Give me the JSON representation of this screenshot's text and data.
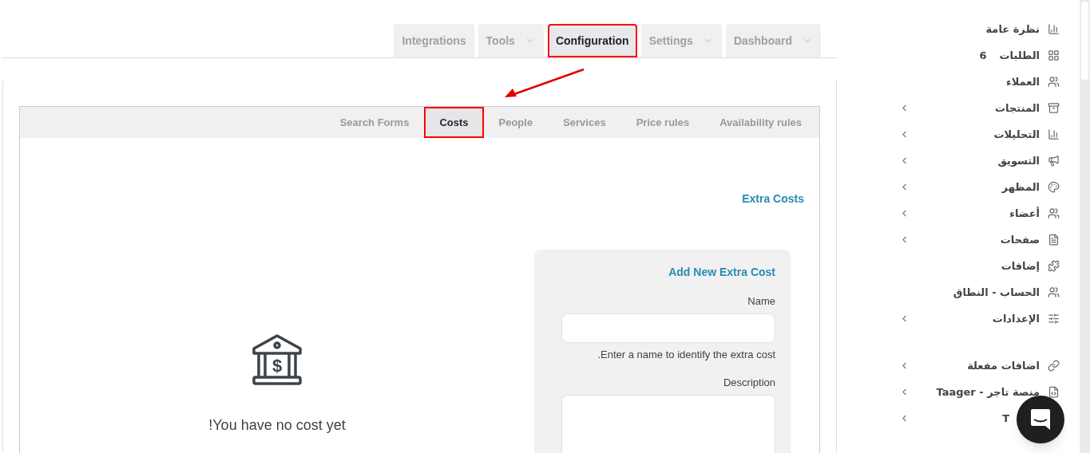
{
  "top_tabs": [
    {
      "label": "Dashboard",
      "selected": false,
      "dropdown": true,
      "highlighted": false
    },
    {
      "label": "Settings",
      "selected": false,
      "dropdown": true,
      "highlighted": false
    },
    {
      "label": "Configuration",
      "selected": true,
      "dropdown": false,
      "highlighted": true
    },
    {
      "label": "Tools",
      "selected": false,
      "dropdown": true,
      "highlighted": false
    },
    {
      "label": "Integrations",
      "selected": false,
      "dropdown": false,
      "highlighted": false
    }
  ],
  "sub_tabs": [
    {
      "label": "Availability rules",
      "selected": false,
      "highlighted": false
    },
    {
      "label": "Price rules",
      "selected": false,
      "highlighted": false
    },
    {
      "label": "Services",
      "selected": false,
      "highlighted": false
    },
    {
      "label": "People",
      "selected": false,
      "highlighted": false
    },
    {
      "label": "Costs",
      "selected": true,
      "highlighted": true
    },
    {
      "label": "Search Forms",
      "selected": false,
      "highlighted": false
    }
  ],
  "section_title": "Extra Costs",
  "empty_state": {
    "icon_symbol": "$",
    "message": "!You have no cost yet"
  },
  "form": {
    "title": "Add New Extra Cost",
    "fields": [
      {
        "kind": "input",
        "label": "Name",
        "help": ".Enter a name to identify the extra cost"
      },
      {
        "kind": "textarea",
        "label": "Description"
      }
    ]
  },
  "sidebar": {
    "groups": [
      {
        "items": [
          {
            "label": "نظرة عامة",
            "expandable": false
          },
          {
            "label": "الطلبات",
            "badge": "6",
            "expandable": false
          },
          {
            "label": "العملاء",
            "expandable": false
          },
          {
            "label": "المنتجات",
            "expandable": true
          },
          {
            "label": "التحليلات",
            "expandable": true
          },
          {
            "label": "التسويق",
            "expandable": true
          },
          {
            "label": "المظهر",
            "expandable": true
          },
          {
            "label": "أعضاء",
            "expandable": true
          },
          {
            "label": "صفحات",
            "expandable": true
          },
          {
            "label": "إضافات",
            "expandable": false
          },
          {
            "label": "الحساب - النطاق",
            "expandable": false
          },
          {
            "label": "الإعدادات",
            "expandable": true
          }
        ]
      },
      {
        "items": [
          {
            "label": "اضافات مفعلة",
            "expandable": true
          },
          {
            "label": "منصة تاجر - Taager",
            "expandable": true
          },
          {
            "label": "T",
            "expandable": true
          }
        ]
      }
    ]
  }
}
